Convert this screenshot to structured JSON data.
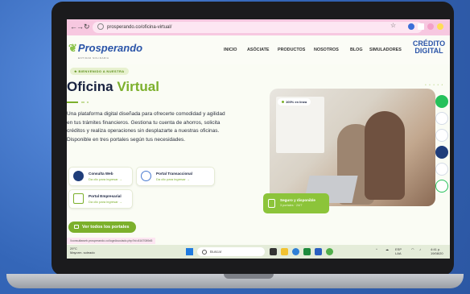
{
  "browser": {
    "url": "prosperando.co/oficina-virtual/",
    "status_url": "//consultaweb.prosperando.co/logeAsociado.php?id=8167089d5"
  },
  "site": {
    "logo": "Prosperando",
    "logo_tagline": "ENTIDAD SOLIDARIA",
    "nav": [
      "INICIO",
      "ASÓCIATE",
      "PRODUCTOS",
      "NOSOTROS",
      "BLOG",
      "SIMULADORES"
    ],
    "credito_line1": "CRÉDITO",
    "credito_line2": "DIGITAL"
  },
  "hero": {
    "badge": "★ BIENVENIDO A NUESTRA",
    "title_part1": "Oficina ",
    "title_part2": "Virtual",
    "description": "Una plataforma digital diseñada para ofrecerte comodidad y agilidad en tus trámites financieros. Gestiona tu cuenta de ahorros, solicita créditos y realiza operaciones sin desplazarte a nuestras oficinas. Disponible en tres portales según tus necesidades."
  },
  "portals": [
    {
      "title": "Consulta Web",
      "subtitle": "Da clic para ingresar →"
    },
    {
      "title": "Portal Transaccional",
      "subtitle": "Da clic para ingresar →"
    },
    {
      "title": "Portal Empresarial",
      "subtitle": "Da clic para ingresar →"
    }
  ],
  "cta": {
    "label": "Ver todos los portales"
  },
  "image": {
    "online_badge": "100% en línea",
    "secure_title": "Seguro y disponible",
    "secure_sub": "3 portales · 24/7"
  },
  "taskbar": {
    "temp": "29°C",
    "weather": "Mayorm. soleado",
    "search_placeholder": "Buscar",
    "lang1": "ESP",
    "lang2": "LAA",
    "time": "4:41 p.",
    "date": "19/08/20"
  },
  "colors": {
    "accent_green": "#7cb02c",
    "brand_blue": "#2a54a8",
    "tab_pink": "#f7c8e0"
  }
}
